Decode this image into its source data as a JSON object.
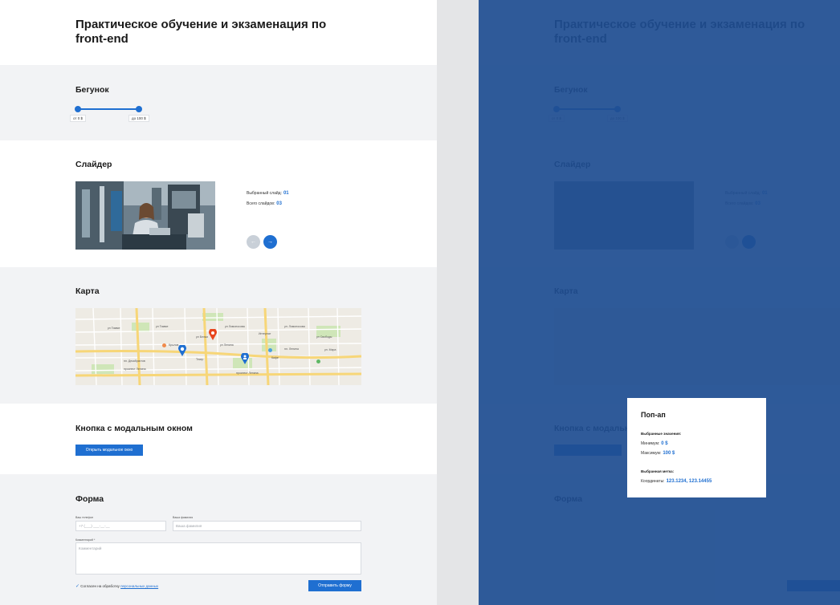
{
  "header": {
    "title": "Практическое обучение и экзаменация по front-end"
  },
  "range_section": {
    "heading": "Бегунок",
    "from_label": "от 0 $",
    "to_label": "до 100 $"
  },
  "slider_section": {
    "heading": "Слайдер",
    "selected_label": "Выбранный слайд:",
    "selected_value": "01",
    "total_label": "Всего слайдов:",
    "total_value": "03",
    "prev_icon": "arrow-left-icon",
    "next_icon": "arrow-right-icon"
  },
  "map_section": {
    "heading": "Карта",
    "street_labels": [
      "ул Тимме",
      "ул Тимме",
      "ул Белых",
      "ул Ломоносова",
      "ул. Ломоносова",
      "ул Свободы",
      "ул Ленина",
      "пл. Ленина",
      "ул. Мира",
      "проспект Ленина",
      "проспект Ленина",
      "Крылов",
      "пл. Декабристов",
      "Интернат",
      "Театр",
      "Кафе"
    ]
  },
  "modal_section": {
    "heading": "Кнопка с модальным окном",
    "button_label": "Открыть модальное окно"
  },
  "form_section": {
    "heading": "Форма",
    "phone_label": "Ваш телефон",
    "phone_placeholder": "+7 (___) ___-__-__",
    "surname_label": "Ваша фамилия",
    "surname_placeholder": "Ваша фамилия",
    "comment_label": "Комментарий *",
    "comment_placeholder": "Комментарий",
    "consent_text": "Согласен на обработку",
    "consent_link": "персональных данных",
    "submit_label": "Отправить форму"
  },
  "popup": {
    "title": "Поп-ап",
    "values_heading": "Выбранные значения:",
    "min_label": "Минимум:",
    "min_value": "0 $",
    "max_label": "Максимум:",
    "max_value": "100 $",
    "marker_heading": "Выбранная метка:",
    "coords_label": "Координаты:",
    "coords_value": "123.1234, 123.14455"
  },
  "colors": {
    "accent": "#1f6fd1",
    "overlay": "#1f4e91",
    "grey_bg": "#f2f3f5",
    "marker_red": "#e8461f"
  }
}
